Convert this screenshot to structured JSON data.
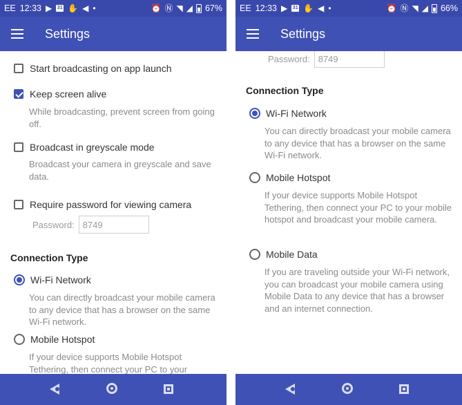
{
  "left": {
    "status": {
      "carrier": "EE",
      "time": "12:33",
      "calendar_day": "31",
      "battery": "67%"
    },
    "appbar": {
      "title": "Settings"
    },
    "settings": {
      "start_broadcasting": {
        "label": "Start broadcasting on app launch",
        "checked": false
      },
      "keep_screen_alive": {
        "label": "Keep screen alive",
        "checked": true,
        "desc": "While broadcasting, prevent screen from going off."
      },
      "greyscale": {
        "label": "Broadcast in greyscale mode",
        "checked": false,
        "desc": "Broadcast your camera in greyscale and save data."
      },
      "require_password": {
        "label": "Require password for viewing camera",
        "checked": false
      },
      "password": {
        "label": "Password:",
        "value": "8749"
      }
    },
    "connection": {
      "heading": "Connection Type",
      "wifi": {
        "label": "Wi-Fi Network",
        "selected": true,
        "desc": "You can directly broadcast your mobile camera to any device that has a browser on the same Wi-Fi network."
      },
      "hotspot": {
        "label": "Mobile Hotspot",
        "selected": false,
        "desc": "If your device supports Mobile Hotspot Tethering, then connect your PC to your"
      }
    }
  },
  "right": {
    "status": {
      "carrier": "EE",
      "time": "12:33",
      "calendar_day": "31",
      "battery": "66%"
    },
    "appbar": {
      "title": "Settings"
    },
    "password": {
      "label": "Password:",
      "value": "8749"
    },
    "connection": {
      "heading": "Connection Type",
      "wifi": {
        "label": "Wi-Fi Network",
        "selected": true,
        "desc": "You can directly broadcast your mobile camera to any device that has a browser on the same Wi-Fi network."
      },
      "hotspot": {
        "label": "Mobile Hotspot",
        "selected": false,
        "desc": "If your device supports Mobile Hotspot Tethering, then connect your PC to your mobile hotspot and broadcast your mobile camera."
      },
      "mobile_data": {
        "label": "Mobile Data",
        "selected": false,
        "desc": "If you are traveling outside your Wi-Fi network, you can broadcast your mobile camera using Mobile Data to any device that has a browser and an internet connection."
      }
    }
  },
  "colors": {
    "status_bar": "#3949ab",
    "app_bar": "#3f51b5",
    "accent": "#3f51b5"
  },
  "icons": {
    "status": [
      "play-icon",
      "calendar-icon",
      "hand-icon",
      "send-icon",
      "dot-icon",
      "alarm-icon",
      "nfc-icon",
      "wifi-icon",
      "signal-icon",
      "battery-icon"
    ],
    "nav": [
      "back-icon",
      "home-icon",
      "recent-apps-icon"
    ]
  }
}
